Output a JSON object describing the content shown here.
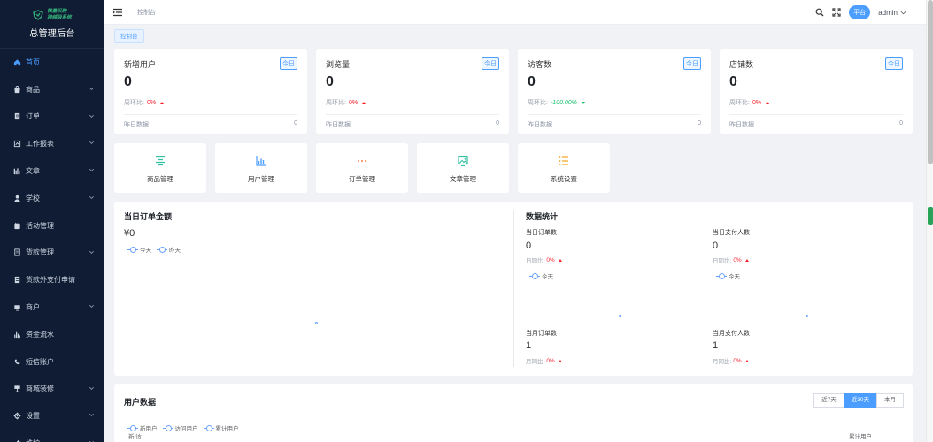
{
  "sidebar": {
    "logo_line1": "微量采购",
    "logo_line2": "跨越级系统",
    "title": "总管理后台",
    "items": [
      {
        "label": "首页",
        "icon": "home-icon",
        "expandable": false,
        "active": true
      },
      {
        "label": "商品",
        "icon": "goods-icon",
        "expandable": true
      },
      {
        "label": "订单",
        "icon": "order-icon",
        "expandable": true
      },
      {
        "label": "工作报表",
        "icon": "report-icon",
        "expandable": true
      },
      {
        "label": "文章",
        "icon": "article-icon",
        "expandable": true
      },
      {
        "label": "学校",
        "icon": "school-icon",
        "expandable": true
      },
      {
        "label": "活动管理",
        "icon": "activity-icon",
        "expandable": false
      },
      {
        "label": "货款管理",
        "icon": "payment-icon",
        "expandable": true
      },
      {
        "label": "货款外支付申请",
        "icon": "apply-icon",
        "expandable": false
      },
      {
        "label": "商户",
        "icon": "merchant-icon",
        "expandable": true
      },
      {
        "label": "资金流水",
        "icon": "flow-icon",
        "expandable": false
      },
      {
        "label": "短信账户",
        "icon": "sms-icon",
        "expandable": false
      },
      {
        "label": "商城装修",
        "icon": "decorate-icon",
        "expandable": true
      },
      {
        "label": "设置",
        "icon": "settings-icon",
        "expandable": true
      },
      {
        "label": "维护",
        "icon": "maintain-icon",
        "expandable": true
      }
    ]
  },
  "topbar": {
    "breadcrumb": "控制台",
    "role": "平台",
    "user": "admin"
  },
  "tagbar": {
    "tag": "控制台"
  },
  "stats": [
    {
      "title": "新增用户",
      "tag": "今日",
      "value": "0",
      "cmp_label": "周环比:",
      "cmp_value": "0%",
      "trend": "up",
      "yest_label": "昨日数据",
      "yest_value": "0"
    },
    {
      "title": "浏览量",
      "tag": "今日",
      "value": "0",
      "cmp_label": "周环比:",
      "cmp_value": "0%",
      "trend": "up",
      "yest_label": "昨日数据",
      "yest_value": "0"
    },
    {
      "title": "访客数",
      "tag": "今日",
      "value": "0",
      "cmp_label": "周环比:",
      "cmp_value": "-100.00%",
      "trend": "down",
      "yest_label": "昨日数据",
      "yest_value": "0"
    },
    {
      "title": "店铺数",
      "tag": "今日",
      "value": "0",
      "cmp_label": "周环比:",
      "cmp_value": "0%",
      "trend": "up",
      "yest_label": "昨日数据",
      "yest_value": "0"
    }
  ],
  "shortcuts": [
    {
      "label": "商品管理",
      "icon": "goods-manage-icon",
      "color": "#2fc1a0"
    },
    {
      "label": "用户管理",
      "icon": "user-manage-icon",
      "color": "#4b9dff"
    },
    {
      "label": "订单管理",
      "icon": "order-manage-icon",
      "color": "#ff7a45"
    },
    {
      "label": "文章管理",
      "icon": "article-manage-icon",
      "color": "#2fc1a0"
    },
    {
      "label": "系统设置",
      "icon": "system-settings-icon",
      "color": "#f5a623"
    }
  ],
  "order_amount": {
    "title": "当日订单金额",
    "value": "¥0",
    "legend": [
      "今天",
      "昨天"
    ]
  },
  "data_stats": {
    "title": "数据统计",
    "legend_today": "今天",
    "kpis": [
      {
        "label": "当日订单数",
        "value": "0",
        "cmp_label": "日同比:",
        "cmp_value": "0%"
      },
      {
        "label": "当日支付人数",
        "value": "0",
        "cmp_label": "日同比:",
        "cmp_value": "0%"
      },
      {
        "label": "当月订单数",
        "value": "1",
        "cmp_label": "月同比:",
        "cmp_value": "0%"
      },
      {
        "label": "当月支付人数",
        "value": "1",
        "cmp_label": "月同比:",
        "cmp_value": "0%"
      }
    ]
  },
  "user_data": {
    "title": "用户数据",
    "ranges": [
      "近7天",
      "近30天",
      "本月"
    ],
    "active_range": 1,
    "legend": [
      "新用户",
      "访问用户",
      "累计用户"
    ],
    "left_axis": "新/访",
    "right_axis": "累计用户"
  },
  "colors": {
    "accent": "#4b9dff",
    "sidebar_bg": "#0f1c33",
    "up": "#f5222d",
    "down": "#19be6b"
  }
}
